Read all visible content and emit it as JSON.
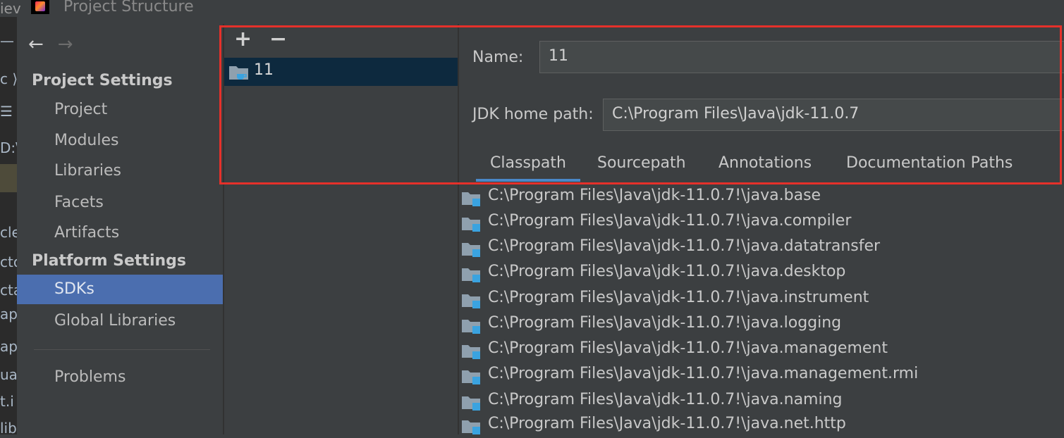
{
  "window": {
    "title": "Project Structure",
    "left_fragment": "iev"
  },
  "background_editor": {
    "fragments": [
      "—",
      "c ⟩",
      "☰",
      "D:\\",
      "cle",
      "cto",
      "cta",
      "ap",
      "ap",
      "ua",
      "t.i",
      "lib"
    ]
  },
  "nav": {
    "back_label": "←",
    "forward_label": "→",
    "project_settings_header": "Project Settings",
    "project_items": [
      "Project",
      "Modules",
      "Libraries",
      "Facets",
      "Artifacts"
    ],
    "platform_settings_header": "Platform Settings",
    "platform_items": [
      "SDKs",
      "Global Libraries"
    ],
    "selected": "SDKs",
    "problems_label": "Problems"
  },
  "sdk_list": {
    "add_label": "+",
    "remove_label": "−",
    "items": [
      "11"
    ]
  },
  "detail": {
    "name_label": "Name:",
    "name_value": "11",
    "jdk_home_label": "JDK home path:",
    "jdk_home_value": "C:\\Program Files\\Java\\jdk-11.0.7",
    "tabs": [
      "Classpath",
      "Sourcepath",
      "Annotations",
      "Documentation Paths"
    ],
    "active_tab": "Classpath",
    "classpath_entries": [
      "C:\\Program Files\\Java\\jdk-11.0.7!\\java.base",
      "C:\\Program Files\\Java\\jdk-11.0.7!\\java.compiler",
      "C:\\Program Files\\Java\\jdk-11.0.7!\\java.datatransfer",
      "C:\\Program Files\\Java\\jdk-11.0.7!\\java.desktop",
      "C:\\Program Files\\Java\\jdk-11.0.7!\\java.instrument",
      "C:\\Program Files\\Java\\jdk-11.0.7!\\java.logging",
      "C:\\Program Files\\Java\\jdk-11.0.7!\\java.management",
      "C:\\Program Files\\Java\\jdk-11.0.7!\\java.management.rmi",
      "C:\\Program Files\\Java\\jdk-11.0.7!\\java.naming",
      "C:\\Program Files\\Java\\jdk-11.0.7!\\java.net.http"
    ]
  },
  "colors": {
    "selection": "#4b6eaf",
    "sdk_row_selection": "#0d293e",
    "tab_underline": "#4a88c7",
    "annotation_border": "#e5302a"
  }
}
